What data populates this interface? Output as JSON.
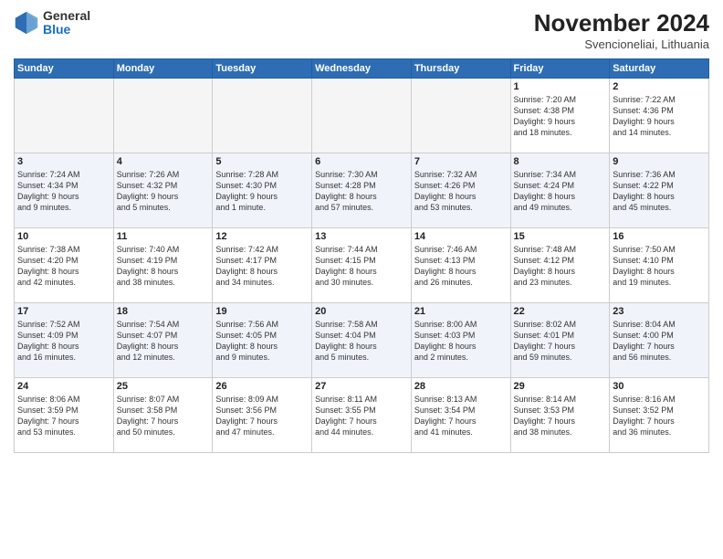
{
  "header": {
    "logo_general": "General",
    "logo_blue": "Blue",
    "month_year": "November 2024",
    "location": "Svencioneliai, Lithuania"
  },
  "weekdays": [
    "Sunday",
    "Monday",
    "Tuesday",
    "Wednesday",
    "Thursday",
    "Friday",
    "Saturday"
  ],
  "weeks": [
    [
      {
        "day": "",
        "info": ""
      },
      {
        "day": "",
        "info": ""
      },
      {
        "day": "",
        "info": ""
      },
      {
        "day": "",
        "info": ""
      },
      {
        "day": "",
        "info": ""
      },
      {
        "day": "1",
        "info": "Sunrise: 7:20 AM\nSunset: 4:38 PM\nDaylight: 9 hours\nand 18 minutes."
      },
      {
        "day": "2",
        "info": "Sunrise: 7:22 AM\nSunset: 4:36 PM\nDaylight: 9 hours\nand 14 minutes."
      }
    ],
    [
      {
        "day": "3",
        "info": "Sunrise: 7:24 AM\nSunset: 4:34 PM\nDaylight: 9 hours\nand 9 minutes."
      },
      {
        "day": "4",
        "info": "Sunrise: 7:26 AM\nSunset: 4:32 PM\nDaylight: 9 hours\nand 5 minutes."
      },
      {
        "day": "5",
        "info": "Sunrise: 7:28 AM\nSunset: 4:30 PM\nDaylight: 9 hours\nand 1 minute."
      },
      {
        "day": "6",
        "info": "Sunrise: 7:30 AM\nSunset: 4:28 PM\nDaylight: 8 hours\nand 57 minutes."
      },
      {
        "day": "7",
        "info": "Sunrise: 7:32 AM\nSunset: 4:26 PM\nDaylight: 8 hours\nand 53 minutes."
      },
      {
        "day": "8",
        "info": "Sunrise: 7:34 AM\nSunset: 4:24 PM\nDaylight: 8 hours\nand 49 minutes."
      },
      {
        "day": "9",
        "info": "Sunrise: 7:36 AM\nSunset: 4:22 PM\nDaylight: 8 hours\nand 45 minutes."
      }
    ],
    [
      {
        "day": "10",
        "info": "Sunrise: 7:38 AM\nSunset: 4:20 PM\nDaylight: 8 hours\nand 42 minutes."
      },
      {
        "day": "11",
        "info": "Sunrise: 7:40 AM\nSunset: 4:19 PM\nDaylight: 8 hours\nand 38 minutes."
      },
      {
        "day": "12",
        "info": "Sunrise: 7:42 AM\nSunset: 4:17 PM\nDaylight: 8 hours\nand 34 minutes."
      },
      {
        "day": "13",
        "info": "Sunrise: 7:44 AM\nSunset: 4:15 PM\nDaylight: 8 hours\nand 30 minutes."
      },
      {
        "day": "14",
        "info": "Sunrise: 7:46 AM\nSunset: 4:13 PM\nDaylight: 8 hours\nand 26 minutes."
      },
      {
        "day": "15",
        "info": "Sunrise: 7:48 AM\nSunset: 4:12 PM\nDaylight: 8 hours\nand 23 minutes."
      },
      {
        "day": "16",
        "info": "Sunrise: 7:50 AM\nSunset: 4:10 PM\nDaylight: 8 hours\nand 19 minutes."
      }
    ],
    [
      {
        "day": "17",
        "info": "Sunrise: 7:52 AM\nSunset: 4:09 PM\nDaylight: 8 hours\nand 16 minutes."
      },
      {
        "day": "18",
        "info": "Sunrise: 7:54 AM\nSunset: 4:07 PM\nDaylight: 8 hours\nand 12 minutes."
      },
      {
        "day": "19",
        "info": "Sunrise: 7:56 AM\nSunset: 4:05 PM\nDaylight: 8 hours\nand 9 minutes."
      },
      {
        "day": "20",
        "info": "Sunrise: 7:58 AM\nSunset: 4:04 PM\nDaylight: 8 hours\nand 5 minutes."
      },
      {
        "day": "21",
        "info": "Sunrise: 8:00 AM\nSunset: 4:03 PM\nDaylight: 8 hours\nand 2 minutes."
      },
      {
        "day": "22",
        "info": "Sunrise: 8:02 AM\nSunset: 4:01 PM\nDaylight: 7 hours\nand 59 minutes."
      },
      {
        "day": "23",
        "info": "Sunrise: 8:04 AM\nSunset: 4:00 PM\nDaylight: 7 hours\nand 56 minutes."
      }
    ],
    [
      {
        "day": "24",
        "info": "Sunrise: 8:06 AM\nSunset: 3:59 PM\nDaylight: 7 hours\nand 53 minutes."
      },
      {
        "day": "25",
        "info": "Sunrise: 8:07 AM\nSunset: 3:58 PM\nDaylight: 7 hours\nand 50 minutes."
      },
      {
        "day": "26",
        "info": "Sunrise: 8:09 AM\nSunset: 3:56 PM\nDaylight: 7 hours\nand 47 minutes."
      },
      {
        "day": "27",
        "info": "Sunrise: 8:11 AM\nSunset: 3:55 PM\nDaylight: 7 hours\nand 44 minutes."
      },
      {
        "day": "28",
        "info": "Sunrise: 8:13 AM\nSunset: 3:54 PM\nDaylight: 7 hours\nand 41 minutes."
      },
      {
        "day": "29",
        "info": "Sunrise: 8:14 AM\nSunset: 3:53 PM\nDaylight: 7 hours\nand 38 minutes."
      },
      {
        "day": "30",
        "info": "Sunrise: 8:16 AM\nSunset: 3:52 PM\nDaylight: 7 hours\nand 36 minutes."
      }
    ]
  ]
}
